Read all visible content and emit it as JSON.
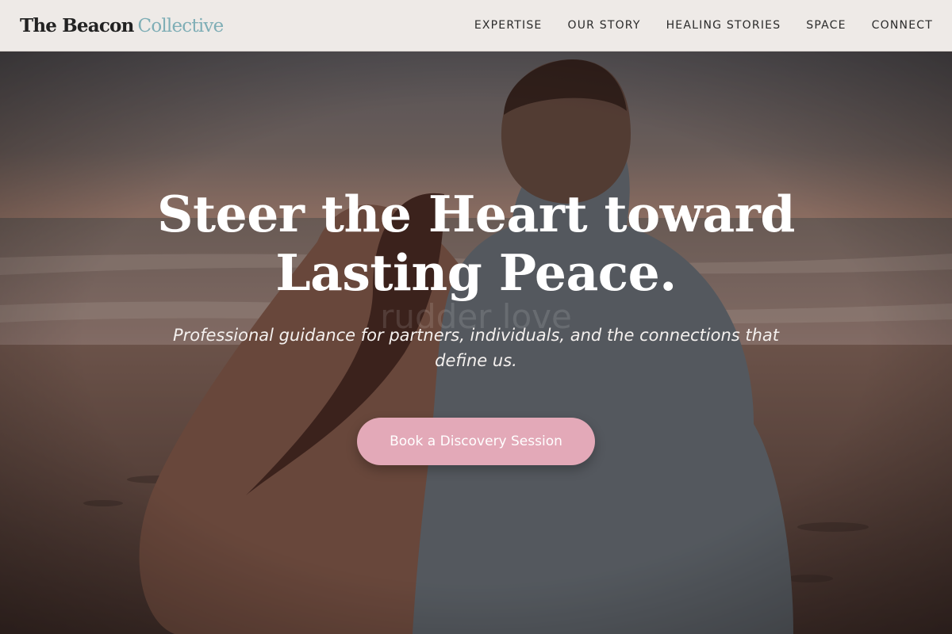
{
  "brand": {
    "name_part1": "The Beacon",
    "name_part2": "Collective"
  },
  "nav": {
    "items": [
      {
        "label": "EXPERTISE"
      },
      {
        "label": "OUR STORY"
      },
      {
        "label": "HEALING STORIES"
      },
      {
        "label": "SPACE"
      },
      {
        "label": "CONNECT"
      }
    ]
  },
  "hero": {
    "title_line1": "Steer the Heart toward",
    "title_line2": "Lasting Peace.",
    "subtitle": "Professional guidance for partners, individuals, and the connections that define us.",
    "cta_label": "Book a Discovery Session",
    "watermark": "rudder love",
    "image": "couple-on-beach-at-sunset"
  },
  "colors": {
    "brand_accent": "#7faeb6",
    "cta_background": "#e3a9b8",
    "header_background": "#eeeae7"
  }
}
